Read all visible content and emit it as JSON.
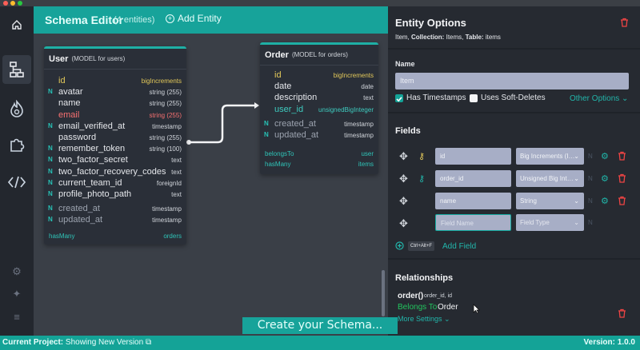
{
  "app": {
    "window_dots": [
      "#ff5f57",
      "#febc2e",
      "#28c840"
    ]
  },
  "sidebar": {
    "items": [
      {
        "icon": "home-icon"
      },
      {
        "icon": "schema-diagram-icon",
        "active": true
      },
      {
        "icon": "fire-icon"
      },
      {
        "icon": "puzzle-icon"
      },
      {
        "icon": "code-icon"
      }
    ],
    "bottom": [
      {
        "icon": "gear-icon"
      },
      {
        "icon": "sparkles-icon"
      },
      {
        "icon": "menu-icon"
      }
    ]
  },
  "canvas": {
    "title": "Schema Editor",
    "entity_count": "(4 entities)",
    "add_entity_label": "Add Entity"
  },
  "entities": {
    "user": {
      "name": "User",
      "model_label": "(MODEL for users)",
      "fields": [
        {
          "name": "id",
          "type": "bigIncrements",
          "style": "pk",
          "nullable": ""
        },
        {
          "name": "avatar",
          "type": "string (255)",
          "style": "normal",
          "nullable": "N"
        },
        {
          "name": "name",
          "type": "string (255)",
          "style": "normal",
          "nullable": ""
        },
        {
          "name": "email",
          "type": "string (255)",
          "style": "red",
          "nullable": ""
        },
        {
          "name": "email_verified_at",
          "type": "timestamp",
          "style": "normal",
          "nullable": "N"
        },
        {
          "name": "password",
          "type": "string (255)",
          "style": "normal",
          "nullable": ""
        },
        {
          "name": "remember_token",
          "type": "string (100)",
          "style": "normal",
          "nullable": "N"
        },
        {
          "name": "two_factor_secret",
          "type": "text",
          "style": "normal",
          "nullable": "N"
        },
        {
          "name": "two_factor_recovery_codes",
          "type": "text",
          "style": "normal",
          "nullable": "N"
        },
        {
          "name": "current_team_id",
          "type": "foreignId",
          "style": "normal",
          "nullable": "N"
        },
        {
          "name": "profile_photo_path",
          "type": "text",
          "style": "normal",
          "nullable": "N"
        },
        {
          "name": "created_at",
          "type": "timestamp",
          "style": "dim",
          "nullable": "N"
        },
        {
          "name": "updated_at",
          "type": "timestamp",
          "style": "dim",
          "nullable": "N"
        }
      ],
      "relations": [
        {
          "type": "hasMany",
          "target": "orders"
        }
      ]
    },
    "order": {
      "name": "Order",
      "model_label": "(MODEL for orders)",
      "fields": [
        {
          "name": "id",
          "type": "bigIncrements",
          "style": "pk",
          "nullable": ""
        },
        {
          "name": "date",
          "type": "date",
          "style": "normal",
          "nullable": ""
        },
        {
          "name": "description",
          "type": "text",
          "style": "normal",
          "nullable": ""
        },
        {
          "name": "user_id",
          "type": "unsignedBigInteger",
          "style": "fk",
          "nullable": ""
        },
        {
          "name": "created_at",
          "type": "timestamp",
          "style": "dim",
          "nullable": "N"
        },
        {
          "name": "updated_at",
          "type": "timestamp",
          "style": "dim",
          "nullable": "N"
        }
      ],
      "relations": [
        {
          "type": "belongsTo",
          "target": "user"
        },
        {
          "type": "hasMany",
          "target": "items"
        }
      ]
    }
  },
  "panel": {
    "title": "Entity Options",
    "subtitle_parts": {
      "item_label": "Item,",
      "collection_key": "Collection:",
      "collection_val": "Items,",
      "table_key": "Table:",
      "table_val": "items"
    },
    "name_label": "Name",
    "name_value": "Item",
    "has_timestamps_label": "Has Timestamps",
    "has_timestamps_checked": true,
    "soft_deletes_label": "Uses Soft-Deletes",
    "soft_deletes_checked": false,
    "other_options_label": "Other Options",
    "fields_heading": "Fields",
    "fields": [
      {
        "name": "id",
        "type": "Big Increments (I…",
        "key": "primary",
        "n": "N"
      },
      {
        "name": "order_id",
        "type": "Unsigned Big Int…",
        "key": "foreign",
        "n": "N"
      },
      {
        "name": "name",
        "type": "String",
        "key": "",
        "n": "N"
      }
    ],
    "new_field": {
      "name_placeholder": "Field Name",
      "type_placeholder": "Field Type",
      "n": "N"
    },
    "add_field_shortcut": "Ctrl+Alt+F",
    "add_field_label": "Add Field",
    "relationships_heading": "Relationships",
    "relationship": {
      "fn": "order()",
      "keys": "order_id, id",
      "type": "Belongs To",
      "target": "Order"
    },
    "more_settings_label": "More Settings"
  },
  "tooltip": "Create your Schema...",
  "status": {
    "project_label": "Current Project:",
    "project_value": "Showing New Version",
    "version": "Version: 1.0.0"
  },
  "colors": {
    "accent": "#14a397",
    "danger": "#ef4444",
    "primary_key": "#e3c95a",
    "foreign_key": "#3ecbbf",
    "relation_green": "#22c55e"
  }
}
